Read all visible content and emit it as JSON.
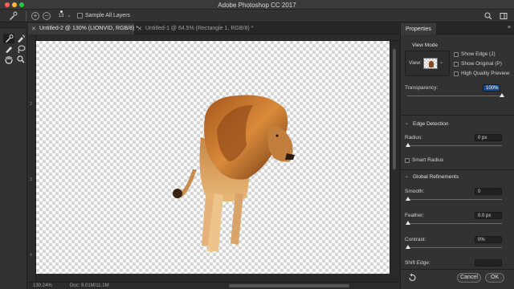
{
  "window": {
    "title": "Adobe Photoshop CC 2017"
  },
  "optionsbar": {
    "brush_size": "13",
    "sample_all_layers": "Sample All Layers"
  },
  "tabs": [
    {
      "label": "Untitled-2 @ 130% (LIONVID, RGB/8) *",
      "active": true
    },
    {
      "label": "Untitled-1 @ 64.5% (Rectangle 1, RGB/8) *",
      "active": false
    }
  ],
  "ruler": {
    "left_numbers": [
      "2",
      "3",
      "4"
    ]
  },
  "status": {
    "zoom": "130.24%",
    "doc": "Doc: 9.01M/11.1M"
  },
  "properties": {
    "title": "Properties",
    "view_mode": {
      "heading": "View Mode",
      "view_label": "View:",
      "show_edge": "Show Edge (J)",
      "show_original": "Show Original (P)",
      "high_quality": "High Quality Preview"
    },
    "transparency": {
      "label": "Transparency:",
      "value": "100%",
      "fraction": 1.0
    },
    "edge_detection": {
      "heading": "Edge Detection",
      "radius_label": "Radius:",
      "radius_value": "0 px",
      "smart_radius": "Smart Radius"
    },
    "global_refinements": {
      "heading": "Global Refinements",
      "smooth_label": "Smooth:",
      "smooth_value": "0",
      "feather_label": "Feather:",
      "feather_value": "0.0 px",
      "contrast_label": "Contrast:",
      "contrast_value": "0%",
      "shift_edge_label": "Shift Edge:"
    },
    "buttons": {
      "cancel": "Cancel",
      "ok": "OK"
    }
  },
  "colors": {
    "accent": "#1e4a86",
    "panel": "#323232",
    "canvas_check": "#d5d5d5"
  }
}
